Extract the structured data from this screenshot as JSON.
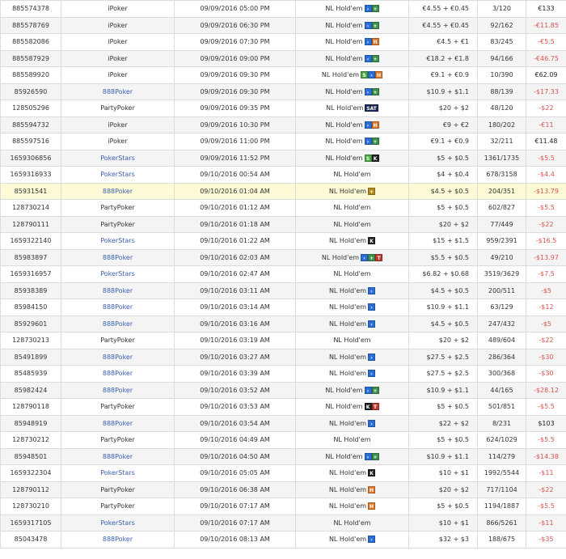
{
  "colors": {
    "speed_badge": "#2b6fd6",
    "plus_badge": "#3f8f4f",
    "h_badge": "#e07a2a",
    "sat_badge": "#1a2a5a",
    "knockout_badge": "#222222",
    "knockout_t_badge": "#c0392b",
    "s_badge": "#4aa843",
    "negative": "#d9534f",
    "link": "#3a5fb0"
  },
  "rows": [
    {
      "id": "885574378",
      "room": "iPoker",
      "date": "09/09/2016 05:00 PM",
      "game": "NL Hold'em",
      "badges": [
        {
          "icon": "speed-icon",
          "text": "›",
          "color": "#2b6fd6"
        },
        {
          "icon": "plus-icon",
          "text": "+",
          "color": "#3f8f4f"
        }
      ],
      "buyin": "€4.55 + €0.45",
      "place": "3/120",
      "result": "€133",
      "neg": false,
      "style": "normal"
    },
    {
      "id": "885578769",
      "room": "iPoker",
      "date": "09/09/2016 06:30 PM",
      "game": "NL Hold'em",
      "badges": [
        {
          "icon": "speed-icon",
          "text": "›",
          "color": "#2b6fd6"
        },
        {
          "icon": "plus-icon",
          "text": "+",
          "color": "#3f8f4f"
        }
      ],
      "buyin": "€4.55 + €0.45",
      "place": "92/162",
      "result": "-€11.85",
      "neg": true,
      "style": "alt"
    },
    {
      "id": "885582086",
      "room": "iPoker",
      "date": "09/09/2016 07:30 PM",
      "game": "NL Hold'em",
      "badges": [
        {
          "icon": "speed-icon",
          "text": "›",
          "color": "#2b6fd6"
        },
        {
          "icon": "h-icon",
          "text": "H",
          "color": "#e07a2a"
        }
      ],
      "buyin": "€4.5 + €1",
      "place": "83/245",
      "result": "-€5.5",
      "neg": true,
      "style": "normal"
    },
    {
      "id": "885587929",
      "room": "iPoker",
      "date": "09/09/2016 09:00 PM",
      "game": "NL Hold'em",
      "badges": [
        {
          "icon": "speed-icon",
          "text": "›",
          "color": "#2b6fd6"
        },
        {
          "icon": "plus-icon",
          "text": "+",
          "color": "#3f8f4f"
        }
      ],
      "buyin": "€18.2 + €1.8",
      "place": "94/166",
      "result": "-€46.75",
      "neg": true,
      "style": "alt"
    },
    {
      "id": "885589920",
      "room": "iPoker",
      "date": "09/09/2016 09:30 PM",
      "game": "NL Hold'em",
      "badges": [
        {
          "icon": "s-icon",
          "text": "S",
          "color": "#4aa843"
        },
        {
          "icon": "speed-icon",
          "text": "›",
          "color": "#2b6fd6"
        },
        {
          "icon": "h-icon",
          "text": "H",
          "color": "#e07a2a"
        }
      ],
      "buyin": "€9.1 + €0.9",
      "place": "10/390",
      "result": "€62.09",
      "neg": false,
      "style": "normal"
    },
    {
      "id": "85926590",
      "room": "888Poker",
      "date": "09/09/2016 09:30 PM",
      "game": "NL Hold'em",
      "badges": [
        {
          "icon": "speed-icon",
          "text": "›",
          "color": "#2b6fd6"
        },
        {
          "icon": "plus-icon",
          "text": "+",
          "color": "#3f8f4f"
        }
      ],
      "buyin": "$10.9 + $1.1",
      "place": "88/139",
      "result": "-$17.33",
      "neg": true,
      "style": "alt"
    },
    {
      "id": "128505296",
      "room": "PartyPoker",
      "date": "09/09/2016 09:35 PM",
      "game": "NL Hold'em",
      "badges": [
        {
          "icon": "sat-icon",
          "text": "SAT",
          "color": "#1a2a5a"
        }
      ],
      "buyin": "$20 + $2",
      "place": "48/120",
      "result": "-$22",
      "neg": true,
      "style": "normal"
    },
    {
      "id": "885594732",
      "room": "iPoker",
      "date": "09/09/2016 10:30 PM",
      "game": "NL Hold'em",
      "badges": [
        {
          "icon": "speed-icon",
          "text": "›",
          "color": "#2b6fd6"
        },
        {
          "icon": "h-icon",
          "text": "H",
          "color": "#e07a2a"
        }
      ],
      "buyin": "€9 + €2",
      "place": "180/202",
      "result": "-€11",
      "neg": true,
      "style": "alt"
    },
    {
      "id": "885597516",
      "room": "iPoker",
      "date": "09/09/2016 11:00 PM",
      "game": "NL Hold'em",
      "badges": [
        {
          "icon": "speed-icon",
          "text": "›",
          "color": "#2b6fd6"
        },
        {
          "icon": "plus-icon",
          "text": "+",
          "color": "#3f8f4f"
        }
      ],
      "buyin": "€9.1 + €0.9",
      "place": "32/211",
      "result": "€11.48",
      "neg": false,
      "style": "normal"
    },
    {
      "id": "1659306856",
      "room": "PokerStars",
      "date": "09/09/2016 11:52 PM",
      "game": "NL Hold'em",
      "badges": [
        {
          "icon": "s-icon",
          "text": "S",
          "color": "#4aa843"
        },
        {
          "icon": "knockout-icon",
          "text": "K",
          "color": "#222222"
        }
      ],
      "buyin": "$5 + $0.5",
      "place": "1361/1735",
      "result": "-$5.5",
      "neg": true,
      "style": "alt"
    },
    {
      "id": "1659316933",
      "room": "PokerStars",
      "date": "09/10/2016 00:54 AM",
      "game": "NL Hold'em",
      "badges": [],
      "buyin": "$4 + $0.4",
      "place": "678/3158",
      "result": "-$4.4",
      "neg": true,
      "style": "normal"
    },
    {
      "id": "85931541",
      "room": "888Poker",
      "date": "09/10/2016 01:04 AM",
      "game": "NL Hold'em",
      "badges": [
        {
          "icon": "plus-icon",
          "text": "+",
          "color": "#b08a1a"
        }
      ],
      "buyin": "$4.5 + $0.5",
      "place": "204/351",
      "result": "-$13.79",
      "neg": true,
      "style": "hl"
    },
    {
      "id": "128730214",
      "room": "PartyPoker",
      "date": "09/10/2016 01:12 AM",
      "game": "NL Hold'em",
      "badges": [],
      "buyin": "$5 + $0.5",
      "place": "602/827",
      "result": "-$5.5",
      "neg": true,
      "style": "normal"
    },
    {
      "id": "128790111",
      "room": "PartyPoker",
      "date": "09/10/2016 01:18 AM",
      "game": "NL Hold'em",
      "badges": [],
      "buyin": "$20 + $2",
      "place": "77/449",
      "result": "-$22",
      "neg": true,
      "style": "alt"
    },
    {
      "id": "1659322140",
      "room": "PokerStars",
      "date": "09/10/2016 01:22 AM",
      "game": "NL Hold'em",
      "badges": [
        {
          "icon": "knockout-icon",
          "text": "K",
          "color": "#222222"
        }
      ],
      "buyin": "$15 + $1.5",
      "place": "959/2391",
      "result": "-$16.5",
      "neg": true,
      "style": "normal"
    },
    {
      "id": "85983897",
      "room": "888Poker",
      "date": "09/10/2016 02:03 AM",
      "game": "NL Hold'em",
      "badges": [
        {
          "icon": "speed-icon",
          "text": "›",
          "color": "#2b6fd6"
        },
        {
          "icon": "plus-icon",
          "text": "+",
          "color": "#3f8f4f"
        },
        {
          "icon": "knockout-t-icon",
          "text": "T",
          "color": "#c0392b"
        }
      ],
      "buyin": "$5.5 + $0.5",
      "place": "49/210",
      "result": "-$13.97",
      "neg": true,
      "style": "alt"
    },
    {
      "id": "1659316957",
      "room": "PokerStars",
      "date": "09/10/2016 02:47 AM",
      "game": "NL Hold'em",
      "badges": [],
      "buyin": "$6.82 + $0.68",
      "place": "3519/3629",
      "result": "-$7.5",
      "neg": true,
      "style": "normal"
    },
    {
      "id": "85938389",
      "room": "888Poker",
      "date": "09/10/2016 03:11 AM",
      "game": "NL Hold'em",
      "badges": [
        {
          "icon": "speed-icon",
          "text": "›",
          "color": "#2b6fd6"
        }
      ],
      "buyin": "$4.5 + $0.5",
      "place": "200/511",
      "result": "-$5",
      "neg": true,
      "style": "alt"
    },
    {
      "id": "85984150",
      "room": "888Poker",
      "date": "09/10/2016 03:14 AM",
      "game": "NL Hold'em",
      "badges": [
        {
          "icon": "speed-icon",
          "text": "›",
          "color": "#2b6fd6"
        }
      ],
      "buyin": "$10.9 + $1.1",
      "place": "63/129",
      "result": "-$12",
      "neg": true,
      "style": "normal"
    },
    {
      "id": "85929601",
      "room": "888Poker",
      "date": "09/10/2016 03:16 AM",
      "game": "NL Hold'em",
      "badges": [
        {
          "icon": "speed-icon",
          "text": "›",
          "color": "#2b6fd6"
        }
      ],
      "buyin": "$4.5 + $0.5",
      "place": "247/432",
      "result": "-$5",
      "neg": true,
      "style": "alt"
    },
    {
      "id": "128730213",
      "room": "PartyPoker",
      "date": "09/10/2016 03:19 AM",
      "game": "NL Hold'em",
      "badges": [],
      "buyin": "$20 + $2",
      "place": "489/604",
      "result": "-$22",
      "neg": true,
      "style": "normal"
    },
    {
      "id": "85491899",
      "room": "888Poker",
      "date": "09/10/2016 03:27 AM",
      "game": "NL Hold'em",
      "badges": [
        {
          "icon": "speed-icon",
          "text": "›",
          "color": "#2b6fd6"
        }
      ],
      "buyin": "$27.5 + $2.5",
      "place": "286/364",
      "result": "-$30",
      "neg": true,
      "style": "alt"
    },
    {
      "id": "85485939",
      "room": "888Poker",
      "date": "09/10/2016 03:39 AM",
      "game": "NL Hold'em",
      "badges": [
        {
          "icon": "speed-icon",
          "text": "›",
          "color": "#2b6fd6"
        }
      ],
      "buyin": "$27.5 + $2.5",
      "place": "300/368",
      "result": "-$30",
      "neg": true,
      "style": "normal"
    },
    {
      "id": "85982424",
      "room": "888Poker",
      "date": "09/10/2016 03:52 AM",
      "game": "NL Hold'em",
      "badges": [
        {
          "icon": "speed-icon",
          "text": "›",
          "color": "#2b6fd6"
        },
        {
          "icon": "plus-icon",
          "text": "+",
          "color": "#3f8f4f"
        }
      ],
      "buyin": "$10.9 + $1.1",
      "place": "44/165",
      "result": "-$28.12",
      "neg": true,
      "style": "alt"
    },
    {
      "id": "128790118",
      "room": "PartyPoker",
      "date": "09/10/2016 03:53 AM",
      "game": "NL Hold'em",
      "badges": [
        {
          "icon": "knockout-icon",
          "text": "K",
          "color": "#222222"
        },
        {
          "icon": "knockout-t-icon",
          "text": "T",
          "color": "#c0392b"
        }
      ],
      "buyin": "$5 + $0.5",
      "place": "501/851",
      "result": "-$5.5",
      "neg": true,
      "style": "normal"
    },
    {
      "id": "85948919",
      "room": "888Poker",
      "date": "09/10/2016 03:54 AM",
      "game": "NL Hold'em",
      "badges": [
        {
          "icon": "speed-icon",
          "text": "›",
          "color": "#2b6fd6"
        }
      ],
      "buyin": "$22 + $2",
      "place": "8/231",
      "result": "$103",
      "neg": false,
      "style": "alt"
    },
    {
      "id": "128730212",
      "room": "PartyPoker",
      "date": "09/10/2016 04:49 AM",
      "game": "NL Hold'em",
      "badges": [],
      "buyin": "$5 + $0.5",
      "place": "624/1029",
      "result": "-$5.5",
      "neg": true,
      "style": "normal"
    },
    {
      "id": "85948501",
      "room": "888Poker",
      "date": "09/10/2016 04:50 AM",
      "game": "NL Hold'em",
      "badges": [
        {
          "icon": "speed-icon",
          "text": "›",
          "color": "#2b6fd6"
        },
        {
          "icon": "plus-icon",
          "text": "+",
          "color": "#3f8f4f"
        }
      ],
      "buyin": "$10.9 + $1.1",
      "place": "114/279",
      "result": "-$14.38",
      "neg": true,
      "style": "alt"
    },
    {
      "id": "1659322304",
      "room": "PokerStars",
      "date": "09/10/2016 05:05 AM",
      "game": "NL Hold'em",
      "badges": [
        {
          "icon": "knockout-icon",
          "text": "K",
          "color": "#222222"
        }
      ],
      "buyin": "$10 + $1",
      "place": "1992/5544",
      "result": "-$11",
      "neg": true,
      "style": "normal"
    },
    {
      "id": "128790112",
      "room": "PartyPoker",
      "date": "09/10/2016 06:38 AM",
      "game": "NL Hold'em",
      "badges": [
        {
          "icon": "h-icon",
          "text": "H",
          "color": "#e07a2a"
        }
      ],
      "buyin": "$20 + $2",
      "place": "717/1104",
      "result": "-$22",
      "neg": true,
      "style": "alt"
    },
    {
      "id": "128730210",
      "room": "PartyPoker",
      "date": "09/10/2016 07:17 AM",
      "game": "NL Hold'em",
      "badges": [
        {
          "icon": "h-icon",
          "text": "H",
          "color": "#e07a2a"
        }
      ],
      "buyin": "$5 + $0.5",
      "place": "1194/1887",
      "result": "-$5.5",
      "neg": true,
      "style": "normal"
    },
    {
      "id": "1659317105",
      "room": "PokerStars",
      "date": "09/10/2016 07:17 AM",
      "game": "NL Hold'em",
      "badges": [],
      "buyin": "$10 + $1",
      "place": "866/5261",
      "result": "-$11",
      "neg": true,
      "style": "alt"
    },
    {
      "id": "85043478",
      "room": "888Poker",
      "date": "09/10/2016 08:13 AM",
      "game": "NL Hold'em",
      "badges": [
        {
          "icon": "speed-icon",
          "text": "›",
          "color": "#2b6fd6"
        }
      ],
      "buyin": "$32 + $3",
      "place": "188/675",
      "result": "-$35",
      "neg": true,
      "style": "normal"
    }
  ]
}
